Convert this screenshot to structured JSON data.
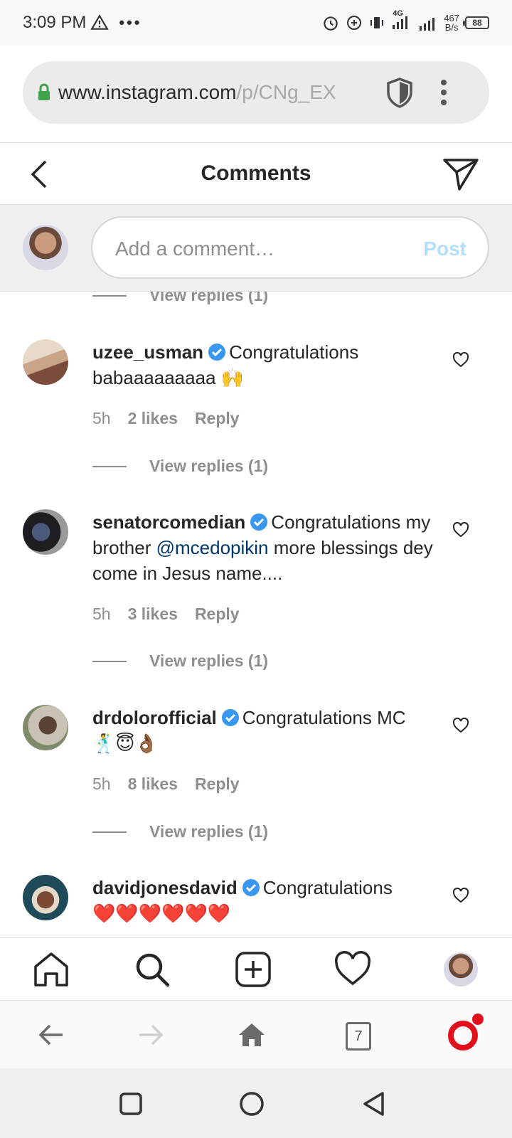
{
  "status_bar": {
    "time": "3:09 PM",
    "dots": "•••",
    "net_speed_value": "467",
    "net_speed_unit": "B/s",
    "network": "4G",
    "battery": "88"
  },
  "browser": {
    "url_host": "www.instagram.com",
    "url_path": "/p/CNg_EX"
  },
  "header": {
    "title": "Comments"
  },
  "add_comment": {
    "placeholder": "Add a comment…",
    "post_label": "Post"
  },
  "view_replies_label": "View replies (1)",
  "reply_label": "Reply",
  "comments": [
    {
      "username": "uzee_usman",
      "text": "Congratulations babaaaaaaaaa",
      "emoji": "🙌",
      "time": "5h",
      "likes": "2 likes"
    },
    {
      "username": "senatorcomedian",
      "text_before": "Congratulations my brother ",
      "mention": "@mcedopikin",
      "text_after": " more blessings dey come in Jesus name....",
      "time": "5h",
      "likes": "3 likes"
    },
    {
      "username": "drdolorofficial",
      "text": "Congratulations MC",
      "emoji": "🕺😇👌🏾",
      "time": "5h",
      "likes": "8 likes"
    },
    {
      "username": "davidjonesdavid",
      "text": "Congratulations",
      "emoji": "❤️❤️❤️❤️❤️❤️"
    }
  ],
  "tab_count": "7",
  "icons": {
    "back": "chevron-left-icon",
    "send": "paper-plane-icon",
    "like": "heart-outline-icon",
    "verified": "verified-badge-icon",
    "nav": [
      "home-icon",
      "search-icon",
      "new-post-icon",
      "activity-heart-icon",
      "profile-avatar"
    ],
    "browser_nav": [
      "back-arrow-icon",
      "forward-arrow-icon",
      "home-icon",
      "tabs-icon",
      "opera-icon"
    ],
    "system_nav": [
      "recents-square-icon",
      "home-circle-icon",
      "back-triangle-icon"
    ]
  },
  "colors": {
    "link_blue": "#00376b",
    "post_disabled": "#b2dffc",
    "verified_blue": "#3897f0",
    "opera_red": "#e0111b",
    "lock_green": "#3ea34a"
  }
}
